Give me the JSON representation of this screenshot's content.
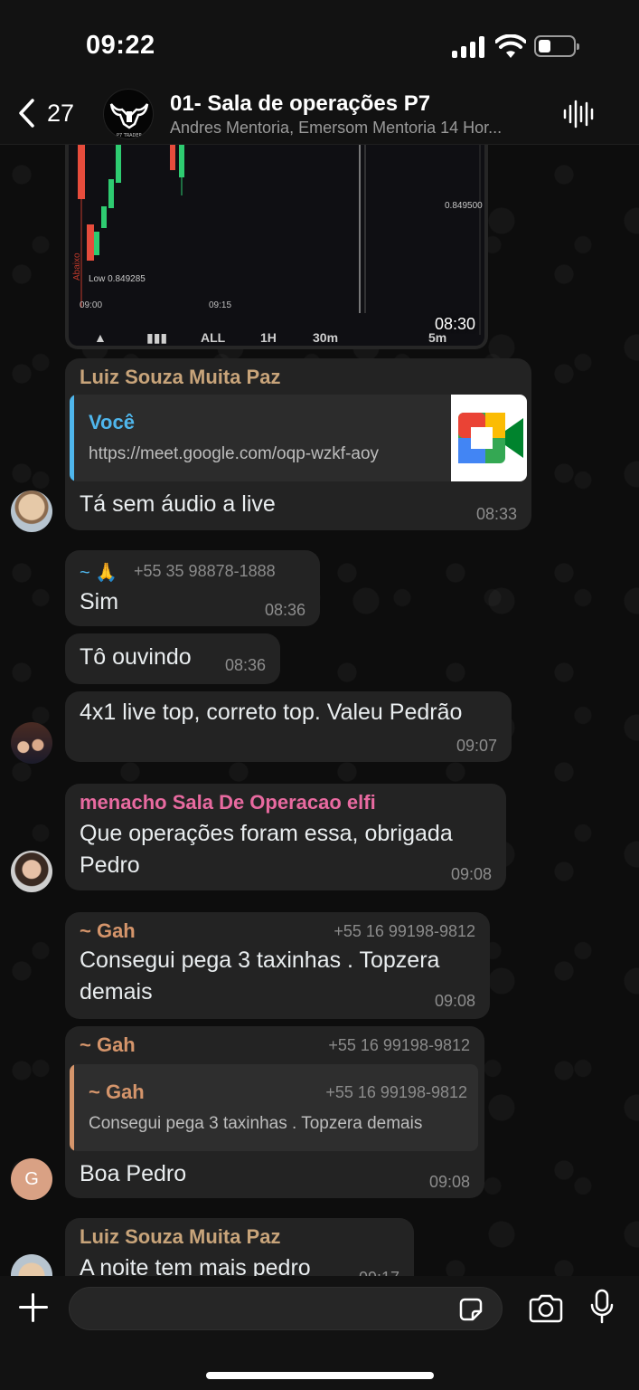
{
  "status_bar": {
    "time": "09:22"
  },
  "header": {
    "back_count": "27",
    "title": "01- Sala de operações P7",
    "subtitle": "Andres Mentoria, Emersom Mentoria 14 Hor...",
    "avatar_caption": "P7 TRADER"
  },
  "chart_image": {
    "low_label": "Low 0.849285",
    "price_label": "0.849500",
    "side_label": "Abaixo",
    "x_labels": [
      "09:00",
      "09:15"
    ],
    "toolbar": [
      "ALL",
      "1H",
      "30m",
      "5m"
    ],
    "time": "08:30"
  },
  "messages": [
    {
      "sender": "Luiz Souza Muita Paz",
      "sender_color": "#c8a47a",
      "quote": {
        "author": "Você",
        "text": "https://meet.google.com/oqp-wzkf-aoy",
        "bar_color": "#4fb6ec"
      },
      "text": "Tá sem áudio a live",
      "time": "08:33"
    },
    {
      "sender": "~ 🙏",
      "phone": "+55 35 98878-1888",
      "text": "Sim",
      "time": "08:36"
    },
    {
      "text": "Tô ouvindo",
      "time": "08:36"
    },
    {
      "text": "4x1 live top, correto top. Valeu Pedrão",
      "time": "09:07"
    },
    {
      "sender": "menacho Sala De Operacao elfi",
      "sender_color": "#e86aa0",
      "text_lines": [
        "Que operações foram essa, obrigada",
        "Pedro"
      ],
      "time": "09:08"
    },
    {
      "sender": "~ Gah",
      "sender_color": "#d5956b",
      "phone": "+55 16 99198-9812",
      "text_lines": [
        "Consegui pega 3 taxinhas . Topzera",
        "demais"
      ],
      "time": "09:08"
    },
    {
      "sender": "~ Gah",
      "sender_color": "#d5956b",
      "phone": "+55 16 99198-9812",
      "quote": {
        "author": "~ Gah",
        "phone": "+55 16 99198-9812",
        "text": "Consegui pega 3 taxinhas . Topzera demais",
        "bar_color": "#d5956b"
      },
      "text": "Boa Pedro",
      "time": "09:08",
      "avatar_letter": "G"
    },
    {
      "sender": "Luiz Souza Muita Paz",
      "sender_color": "#c8a47a",
      "text": "A noite tem mais pedro",
      "time": "09:17"
    }
  ],
  "icons": {
    "back": "chevron-left-icon",
    "audio": "waveform-icon",
    "plus": "plus-icon",
    "sticker": "sticker-icon",
    "camera": "camera-icon",
    "mic": "microphone-icon"
  },
  "colors": {
    "background": "#0b0b0b",
    "bubble": "#232323",
    "accent": "#4fb6ec"
  }
}
